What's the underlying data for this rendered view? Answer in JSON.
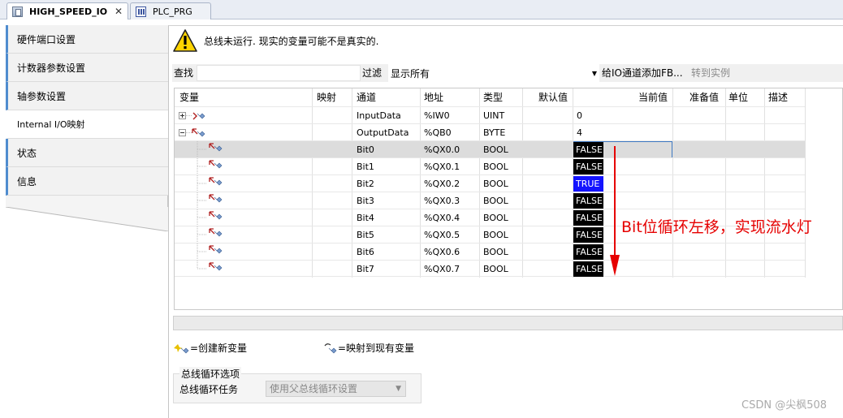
{
  "tabs": [
    {
      "label": "HIGH_SPEED_IO",
      "active": true
    },
    {
      "label": "PLC_PRG",
      "active": false
    }
  ],
  "nav": [
    {
      "label": "硬件端口设置",
      "active": false
    },
    {
      "label": "计数器参数设置",
      "active": false
    },
    {
      "label": "轴参数设置",
      "active": false
    },
    {
      "label": "Internal I/O映射",
      "active": true
    },
    {
      "label": "状态",
      "active": false
    },
    {
      "label": "信息",
      "active": false
    }
  ],
  "warning": "总线未运行. 现实的变量可能不是真实的.",
  "toolbar": {
    "find_label": "查找",
    "filter_label": "过滤",
    "filter_value": "显示所有",
    "add_fb_label": "给IO通道添加FB...",
    "goto_instance_label": "转到实例"
  },
  "columns": {
    "variable": "变量",
    "mapping": "映射",
    "channel": "通道",
    "address": "地址",
    "type": "类型",
    "default": "默认值",
    "current": "当前值",
    "prepared": "准备值",
    "unit": "单位",
    "description": "描述"
  },
  "rows": [
    {
      "channel": "InputData",
      "address": "%IW0",
      "type": "UINT",
      "current": "0"
    },
    {
      "channel": "OutputData",
      "address": "%QB0",
      "type": "BYTE",
      "current": "4"
    },
    {
      "channel": "Bit0",
      "address": "%QX0.0",
      "type": "BOOL",
      "current": "FALSE"
    },
    {
      "channel": "Bit1",
      "address": "%QX0.1",
      "type": "BOOL",
      "current": "FALSE"
    },
    {
      "channel": "Bit2",
      "address": "%QX0.2",
      "type": "BOOL",
      "current": "TRUE"
    },
    {
      "channel": "Bit3",
      "address": "%QX0.3",
      "type": "BOOL",
      "current": "FALSE"
    },
    {
      "channel": "Bit4",
      "address": "%QX0.4",
      "type": "BOOL",
      "current": "FALSE"
    },
    {
      "channel": "Bit5",
      "address": "%QX0.5",
      "type": "BOOL",
      "current": "FALSE"
    },
    {
      "channel": "Bit6",
      "address": "%QX0.6",
      "type": "BOOL",
      "current": "FALSE"
    },
    {
      "channel": "Bit7",
      "address": "%QX0.7",
      "type": "BOOL",
      "current": "FALSE"
    }
  ],
  "legend": {
    "create": "=创建新变量",
    "map": "=映射到现有变量"
  },
  "bus_cycle": {
    "title": "总线循环选项",
    "task_label": "总线循环任务",
    "task_value": "使用父总线循环设置"
  },
  "annotation": "Bit位循环左移，实现流水灯",
  "watermark": "CSDN @尖枫508",
  "colors": {
    "true_bg": "#1414ff",
    "false_bg": "#000000",
    "annotation": "#e60000",
    "nav_accent": "#4f8ccf"
  }
}
